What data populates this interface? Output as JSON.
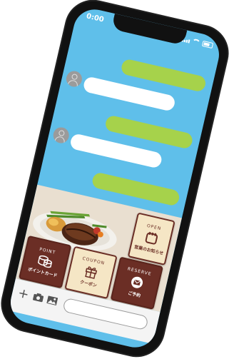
{
  "status": {
    "time": "0:00"
  },
  "rich_menu": {
    "open": {
      "en": "OPEN",
      "jp": "営業のお知らせ",
      "icon": "notepad-icon"
    },
    "point": {
      "en": "POINT",
      "jp": "ポイントカード",
      "icon": "coins-icon"
    },
    "coupon": {
      "en": "COUPON",
      "jp": "クーポン",
      "icon": "gift-icon"
    },
    "reserve": {
      "en": "RESERVE",
      "jp": "ご予約",
      "icon": "envelope-icon"
    }
  },
  "input_bar": {
    "placeholder": ""
  },
  "colors": {
    "chat_bg": "#5fbfea",
    "outgoing_bubble": "#a6d24b",
    "incoming_bubble": "#ffffff",
    "menu_bg": "#e9dfd0",
    "tile_dark": "#6b2e25",
    "tile_light": "#f5e6c5"
  }
}
